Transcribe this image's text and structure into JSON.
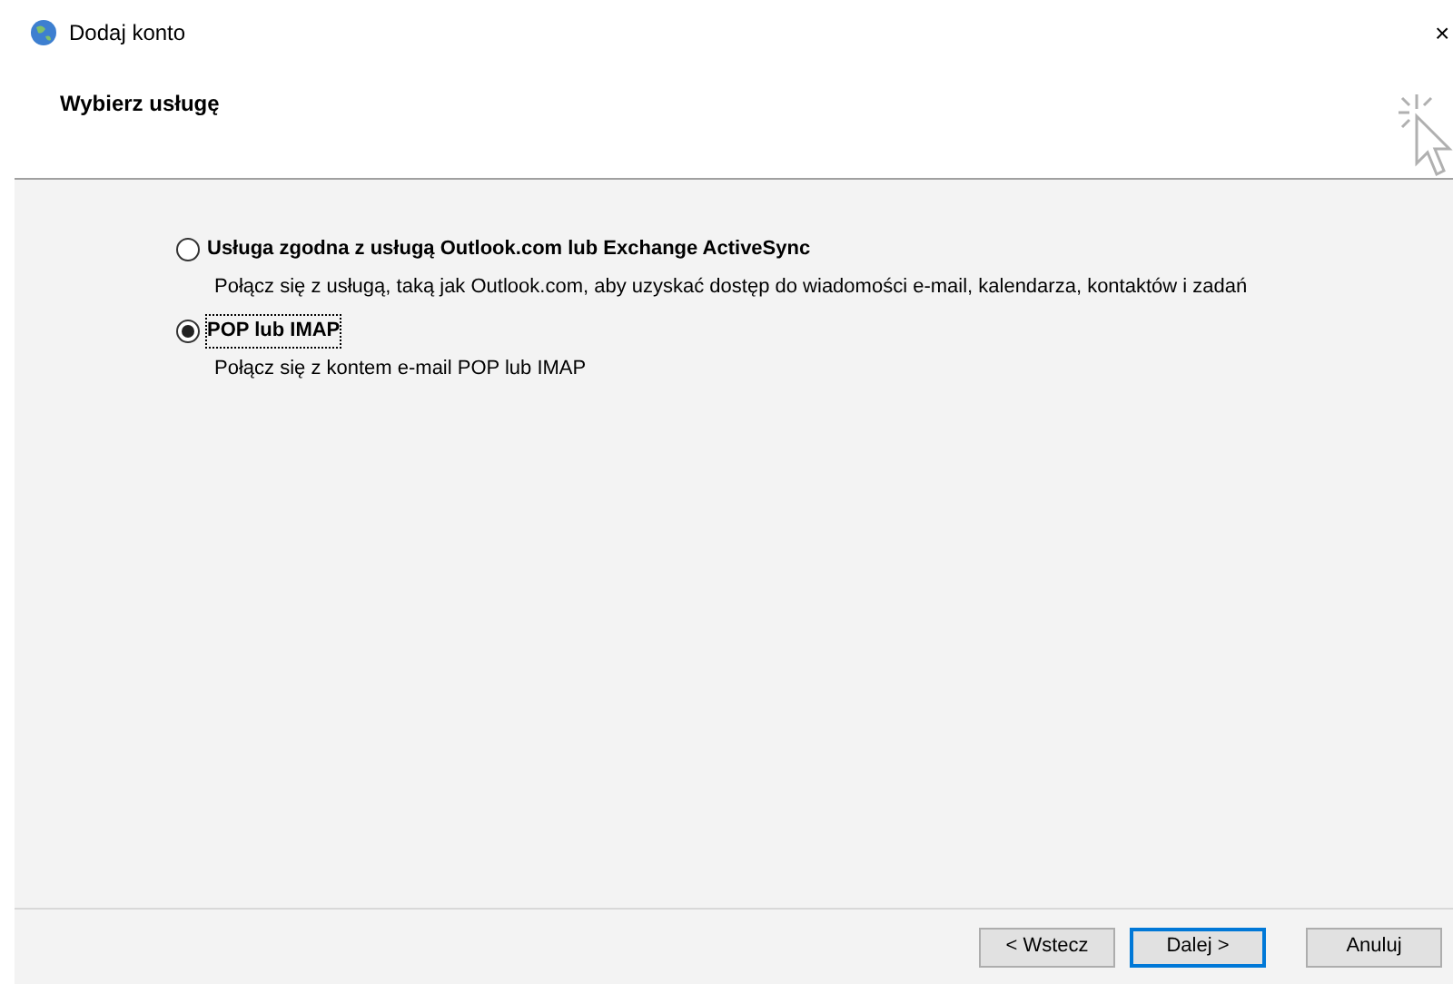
{
  "window": {
    "title": "Dodaj konto",
    "close": "×"
  },
  "header": {
    "title": "Wybierz usługę"
  },
  "options": [
    {
      "label": "Usługa zgodna z usługą Outlook.com lub Exchange ActiveSync",
      "description": "Połącz się z usługą, taką jak Outlook.com, aby uzyskać dostęp do wiadomości e-mail, kalendarza, kontaktów i zadań",
      "selected": false
    },
    {
      "label": "POP lub IMAP",
      "description": "Połącz się z kontem e-mail POP lub IMAP",
      "selected": true
    }
  ],
  "buttons": [
    {
      "label": "< Wstecz",
      "kind": "normal"
    },
    {
      "label": "Dalej >",
      "kind": "default"
    },
    {
      "label": "Anuluj",
      "kind": "normal"
    }
  ]
}
